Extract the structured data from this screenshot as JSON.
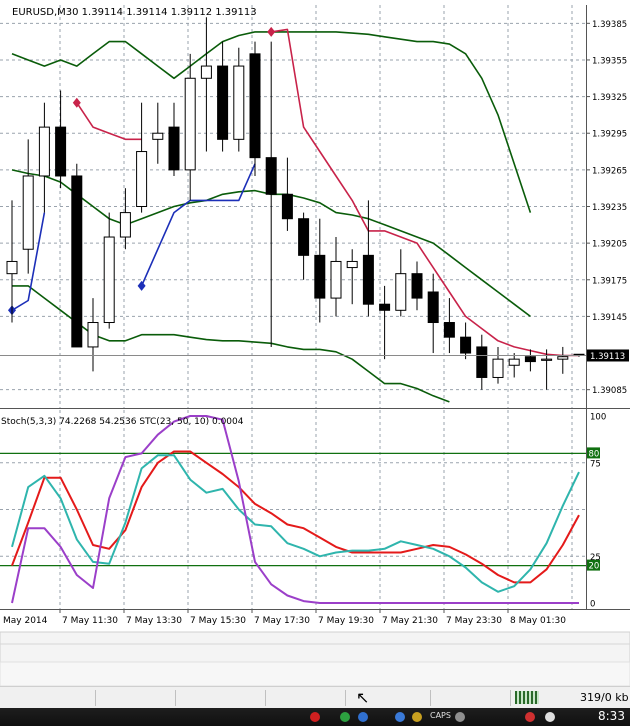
{
  "colors": {
    "background": "#ffffff",
    "grid": "#9aa3ad",
    "bull_candle": "#ffffff",
    "bear_candle": "#000000",
    "bands": "#0a5c0a",
    "trail_up": "#1c2fb8",
    "trail_down": "#c8234a",
    "stoch_main": "#e41a1a",
    "stoch_signal": "#2fb5ad",
    "stc": "#9b3fc9",
    "levels": "#107010"
  },
  "header": {
    "title": "EURUSD,M30  1.39114 1.39114 1.39112 1.39113"
  },
  "price_axis": {
    "labels": [
      "1.39385",
      "1.39355",
      "1.39325",
      "1.39295",
      "1.39265",
      "1.39235",
      "1.39205",
      "1.39175",
      "1.39145",
      "1.39085"
    ],
    "current_price": "1.39113"
  },
  "indicator": {
    "label": "Stoch(5,3,3) 74.2268 54.2536  STC(23, 50, 10) 0.0004",
    "axis_labels": [
      "100",
      "75",
      "25",
      "0"
    ],
    "level_high": "80",
    "level_low": "20"
  },
  "time_axis": {
    "labels": [
      "May 2014",
      "7 May 11:30",
      "7 May 13:30",
      "7 May 15:30",
      "7 May 17:30",
      "7 May 19:30",
      "7 May 21:30",
      "7 May 23:30",
      "8 May 01:30"
    ]
  },
  "status_bar": {
    "traffic": "319/0 kb"
  },
  "taskbar": {
    "caps": "CAPS",
    "clock": "8:33"
  },
  "chart_data": [
    {
      "type": "candlestick",
      "symbol": "EURUSD",
      "timeframe": "M30",
      "ylim": [
        1.3907,
        1.394
      ],
      "candles": [
        {
          "o": 1.3918,
          "h": 1.3924,
          "l": 1.3914,
          "c": 1.3919
        },
        {
          "o": 1.392,
          "h": 1.3929,
          "l": 1.3918,
          "c": 1.3926
        },
        {
          "o": 1.3926,
          "h": 1.3932,
          "l": 1.3923,
          "c": 1.393
        },
        {
          "o": 1.393,
          "h": 1.3933,
          "l": 1.3925,
          "c": 1.3926
        },
        {
          "o": 1.3926,
          "h": 1.3927,
          "l": 1.3912,
          "c": 1.3912
        },
        {
          "o": 1.3912,
          "h": 1.3916,
          "l": 1.391,
          "c": 1.3914
        },
        {
          "o": 1.3914,
          "h": 1.3923,
          "l": 1.39135,
          "c": 1.3921
        },
        {
          "o": 1.3921,
          "h": 1.3925,
          "l": 1.392,
          "c": 1.3923
        },
        {
          "o": 1.39235,
          "h": 1.3932,
          "l": 1.3923,
          "c": 1.3928
        },
        {
          "o": 1.3929,
          "h": 1.3932,
          "l": 1.3927,
          "c": 1.39295
        },
        {
          "o": 1.393,
          "h": 1.3932,
          "l": 1.3926,
          "c": 1.39265
        },
        {
          "o": 1.39265,
          "h": 1.3936,
          "l": 1.3924,
          "c": 1.3934
        },
        {
          "o": 1.3934,
          "h": 1.3939,
          "l": 1.3928,
          "c": 1.3935
        },
        {
          "o": 1.3935,
          "h": 1.3937,
          "l": 1.3928,
          "c": 1.3929
        },
        {
          "o": 1.3929,
          "h": 1.39365,
          "l": 1.3928,
          "c": 1.3935
        },
        {
          "o": 1.3936,
          "h": 1.3937,
          "l": 1.3926,
          "c": 1.39275
        },
        {
          "o": 1.39275,
          "h": 1.3937,
          "l": 1.3912,
          "c": 1.39245
        },
        {
          "o": 1.39245,
          "h": 1.39275,
          "l": 1.39215,
          "c": 1.39225
        },
        {
          "o": 1.39225,
          "h": 1.3923,
          "l": 1.39175,
          "c": 1.39195
        },
        {
          "o": 1.39195,
          "h": 1.39225,
          "l": 1.3914,
          "c": 1.3916
        },
        {
          "o": 1.3916,
          "h": 1.3921,
          "l": 1.39145,
          "c": 1.3919
        },
        {
          "o": 1.39185,
          "h": 1.392,
          "l": 1.39155,
          "c": 1.3919
        },
        {
          "o": 1.39195,
          "h": 1.3924,
          "l": 1.39145,
          "c": 1.39155
        },
        {
          "o": 1.39155,
          "h": 1.3917,
          "l": 1.3911,
          "c": 1.3915
        },
        {
          "o": 1.3915,
          "h": 1.392,
          "l": 1.39145,
          "c": 1.3918
        },
        {
          "o": 1.3918,
          "h": 1.3919,
          "l": 1.3915,
          "c": 1.3916
        },
        {
          "o": 1.39165,
          "h": 1.3918,
          "l": 1.39115,
          "c": 1.3914
        },
        {
          "o": 1.3914,
          "h": 1.3916,
          "l": 1.39115,
          "c": 1.39128
        },
        {
          "o": 1.39128,
          "h": 1.3914,
          "l": 1.3911,
          "c": 1.39115
        },
        {
          "o": 1.3912,
          "h": 1.3913,
          "l": 1.39085,
          "c": 1.39095
        },
        {
          "o": 1.39095,
          "h": 1.3912,
          "l": 1.3909,
          "c": 1.3911
        },
        {
          "o": 1.39105,
          "h": 1.39115,
          "l": 1.39095,
          "c": 1.3911
        },
        {
          "o": 1.39112,
          "h": 1.39118,
          "l": 1.391,
          "c": 1.39108
        },
        {
          "o": 1.3911,
          "h": 1.39118,
          "l": 1.39085,
          "c": 1.3911
        },
        {
          "o": 1.3911,
          "h": 1.3912,
          "l": 1.39098,
          "c": 1.39112
        },
        {
          "o": 1.39114,
          "h": 1.39114,
          "l": 1.39112,
          "c": 1.39113
        }
      ],
      "series": [
        {
          "type": "line",
          "values": [
            1.3936,
            1.39355,
            1.3935,
            1.39355,
            1.3935,
            1.3936,
            1.3937,
            1.3937,
            1.3936,
            1.3935,
            1.3934,
            1.3935,
            1.3936,
            1.3937,
            1.39375,
            1.39378,
            1.39378,
            1.39378,
            1.39378,
            1.39378,
            1.39378,
            1.39377,
            1.39376,
            1.39374,
            1.39372,
            1.3937,
            1.3937,
            1.39368,
            1.3936,
            1.3934,
            1.3931,
            1.3927,
            1.3923
          ]
        },
        {
          "type": "line",
          "values": [
            1.39265,
            1.39262,
            1.3926,
            1.39255,
            1.39245,
            1.39235,
            1.39225,
            1.3922,
            1.39225,
            1.3923,
            1.39235,
            1.39238,
            1.3924,
            1.39245,
            1.39247,
            1.39248,
            1.39245,
            1.39245,
            1.39242,
            1.39238,
            1.3923,
            1.39228,
            1.39225,
            1.3922,
            1.39215,
            1.3921,
            1.39205,
            1.39195,
            1.39185,
            1.39175,
            1.39165,
            1.39155,
            1.39145
          ]
        },
        {
          "type": "line",
          "values": [
            1.3917,
            1.3917,
            1.3916,
            1.3915,
            1.3914,
            1.3913,
            1.39125,
            1.39125,
            1.3913,
            1.3913,
            1.3913,
            1.39128,
            1.39126,
            1.39125,
            1.39125,
            1.39124,
            1.39123,
            1.3912,
            1.39118,
            1.39118,
            1.39116,
            1.3911,
            1.391,
            1.3909,
            1.3909,
            1.39086,
            1.3908,
            1.39075
          ]
        },
        {
          "type": "line",
          "values": [
            1.3915,
            1.39158,
            1.3923,
            null,
            null,
            null,
            null,
            null,
            1.3917,
            1.392,
            1.3923,
            1.3924,
            1.3924,
            1.3924,
            1.3924,
            1.3927
          ]
        },
        {
          "type": "line",
          "values": [
            null,
            null,
            null,
            null,
            1.3932,
            1.393,
            1.39295,
            1.3929,
            1.3929,
            null,
            null,
            null,
            null,
            null,
            null,
            null,
            1.39378,
            1.3938,
            1.393,
            1.3928,
            1.3926,
            1.3924,
            1.39215,
            1.39215,
            1.3921,
            1.39205,
            1.39185,
            1.39165,
            1.39145,
            1.39135,
            1.39125,
            1.3912,
            1.39117,
            1.39114,
            1.39113,
            1.39113
          ]
        }
      ]
    },
    {
      "type": "line",
      "ylim": [
        0,
        100
      ],
      "levels": [
        80,
        20
      ],
      "series": [
        {
          "values": [
            20,
            43,
            67,
            67,
            50,
            31,
            29,
            39,
            62,
            75,
            81,
            81,
            75,
            69,
            62,
            53,
            48,
            42,
            40,
            35,
            30,
            27,
            27,
            27,
            27,
            29,
            31,
            30,
            26,
            21,
            15,
            11,
            11,
            18,
            31,
            47
          ]
        },
        {
          "values": [
            30,
            62,
            68,
            56,
            34,
            22,
            21,
            43,
            72,
            79,
            79,
            66,
            59,
            61,
            50,
            42,
            41,
            32,
            29,
            25,
            27,
            28,
            28,
            29,
            33,
            31,
            29,
            25,
            19,
            11,
            6,
            9,
            18,
            32,
            52,
            70
          ]
        },
        {
          "values": [
            0,
            40,
            40,
            30,
            15,
            8,
            56,
            78,
            80,
            90,
            97,
            100,
            100,
            98,
            65,
            22,
            10,
            4,
            1,
            0,
            0,
            0,
            0,
            0,
            0,
            0,
            0,
            0,
            0,
            0,
            0,
            0,
            0,
            0,
            0,
            0
          ]
        }
      ]
    }
  ]
}
